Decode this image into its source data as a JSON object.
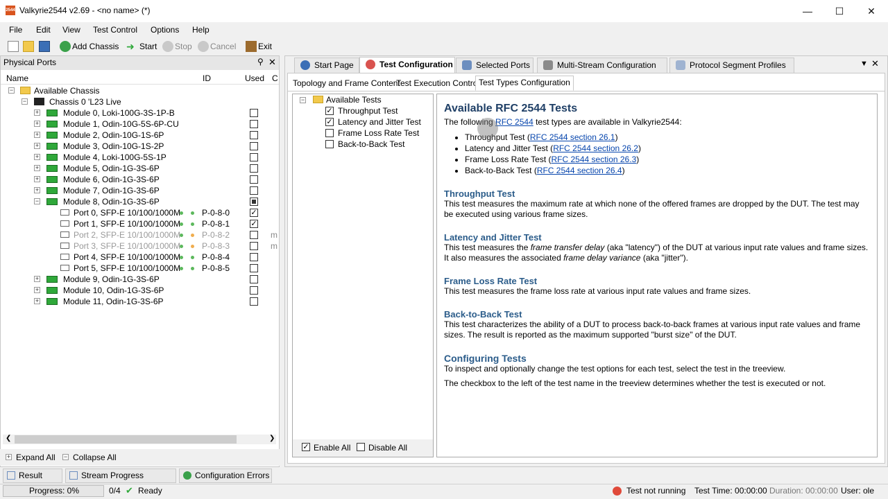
{
  "window": {
    "title": "Valkyrie2544 v2.69 - <no name> (*)",
    "icon_text": "2544"
  },
  "menu": [
    "File",
    "Edit",
    "View",
    "Test Control",
    "Options",
    "Help"
  ],
  "toolbar": {
    "add_chassis": "Add Chassis",
    "start": "Start",
    "stop": "Stop",
    "cancel": "Cancel",
    "exit": "Exit"
  },
  "left_panel": {
    "title": "Physical Ports",
    "columns": {
      "name": "Name",
      "id": "ID",
      "used": "Used",
      "c": "C"
    },
    "root": "Available Chassis",
    "chassis": "Chassis 0 'L23 Live",
    "modules": [
      {
        "label": "Module 0, Loki-100G-3S-1P-B",
        "used": "unchecked"
      },
      {
        "label": "Module 1, Odin-10G-5S-6P-CU",
        "used": "unchecked"
      },
      {
        "label": "Module 2, Odin-10G-1S-6P",
        "used": "unchecked"
      },
      {
        "label": "Module 3, Odin-10G-1S-2P",
        "used": "unchecked"
      },
      {
        "label": "Module 4, Loki-100G-5S-1P",
        "used": "unchecked"
      },
      {
        "label": "Module 5, Odin-1G-3S-6P",
        "used": "unchecked"
      },
      {
        "label": "Module 6, Odin-1G-3S-6P",
        "used": "unchecked"
      },
      {
        "label": "Module 7, Odin-1G-3S-6P",
        "used": "unchecked"
      },
      {
        "label": "Module 8, Odin-1G-3S-6P",
        "used": "partial"
      }
    ],
    "ports": [
      {
        "label": "Port 0, SFP-E 10/100/1000M",
        "id": "P-0-8-0",
        "used": "checked",
        "c": "",
        "dot": "#5cb85c",
        "disabled": false
      },
      {
        "label": "Port 1, SFP-E 10/100/1000M",
        "id": "P-0-8-1",
        "used": "checked",
        "c": "",
        "dot": "#5cb85c",
        "disabled": false
      },
      {
        "label": "Port 2, SFP-E 10/100/1000M",
        "id": "P-0-8-2",
        "used": "unchecked",
        "c": "m",
        "dot": "#f0ad4e",
        "disabled": true
      },
      {
        "label": "Port 3, SFP-E 10/100/1000M",
        "id": "P-0-8-3",
        "used": "unchecked",
        "c": "m",
        "dot": "#f0ad4e",
        "disabled": true
      },
      {
        "label": "Port 4, SFP-E 10/100/1000M",
        "id": "P-0-8-4",
        "used": "unchecked",
        "c": "",
        "dot": "#5cb85c",
        "disabled": false
      },
      {
        "label": "Port 5, SFP-E 10/100/1000M",
        "id": "P-0-8-5",
        "used": "unchecked",
        "c": "",
        "dot": "#5cb85c",
        "disabled": false
      }
    ],
    "modules_after": [
      {
        "label": "Module 9, Odin-1G-3S-6P",
        "used": "unchecked"
      },
      {
        "label": "Module 10, Odin-1G-3S-6P",
        "used": "unchecked"
      },
      {
        "label": "Module 11, Odin-1G-3S-6P",
        "used": "unchecked"
      }
    ],
    "expand_all": "Expand All",
    "collapse_all": "Collapse All"
  },
  "tabs": [
    "Start Page",
    "Test Configuration",
    "Selected Ports",
    "Multi-Stream Configuration",
    "Protocol Segment Profiles"
  ],
  "active_tab": "Test Configuration",
  "subtabs": [
    "Topology and Frame Content",
    "Test Execution Control",
    "Test Types Configuration"
  ],
  "test_tree": {
    "root": "Available Tests",
    "items": [
      {
        "label": "Throughput Test",
        "checked": true
      },
      {
        "label": "Latency and Jitter Test",
        "checked": true
      },
      {
        "label": "Frame Loss Rate Test",
        "checked": false
      },
      {
        "label": "Back-to-Back Test",
        "checked": false
      }
    ],
    "enable_all": "Enable All",
    "disable_all": "Disable All"
  },
  "doc": {
    "heading": "Available RFC 2544 Tests",
    "intro_pre": "The following ",
    "intro_link": "RFC 2544",
    "intro_post": " test types are available in Valkyrie2544:",
    "bullets": [
      {
        "text": "Throughput Test (",
        "link": "RFC 2544 section 26.1",
        "end": ")"
      },
      {
        "text": "Latency and Jitter Test (",
        "link": "RFC 2544 section 26.2",
        "end": ")"
      },
      {
        "text": "Frame Loss Rate Test (",
        "link": "RFC 2544 section 26.3",
        "end": ")"
      },
      {
        "text": "Back-to-Back Test (",
        "link": "RFC 2544 section 26.4",
        "end": ")"
      }
    ],
    "throughput_h": "Throughput Test",
    "throughput_p": "This test measures the maximum rate at which none of the offered frames are dropped by the DUT. The test may be executed using various frame sizes.",
    "latency_h": "Latency and Jitter Test",
    "latency_p1": "This test measures the ",
    "latency_em1": "frame transfer delay",
    "latency_p2": " (aka \"latency\") of the DUT at various input rate values and frame sizes. It also measures the associated ",
    "latency_em2": "frame delay variance",
    "latency_p3": " (aka \"jitter\").",
    "frameloss_h": "Frame Loss Rate Test",
    "frameloss_p": "This test measures the frame loss rate at various input rate values and frame sizes.",
    "b2b_h": "Back-to-Back Test",
    "b2b_p": "This test characterizes the ability of a DUT to process back-to-back frames at various input rate values and frame sizes. The result is reported as the maximum supported \"burst size\" of the DUT.",
    "config_h": "Configuring Tests",
    "config_p1": "To inspect and optionally change the test options for each test, select the test in the treeview.",
    "config_p2": "The checkbox to the left of the test name in the treeview determines whether the test is executed or not."
  },
  "bottom_tabs": [
    "Result Data",
    "Stream Progress Counters",
    "Configuration Errors"
  ],
  "status": {
    "progress": "Progress: 0%",
    "count": "0/4",
    "ready": "Ready",
    "test_state": "Test not running",
    "test_time": "Test Time: 00:00:00",
    "duration": "Duration: 00:00:00",
    "user": "User: ole"
  }
}
